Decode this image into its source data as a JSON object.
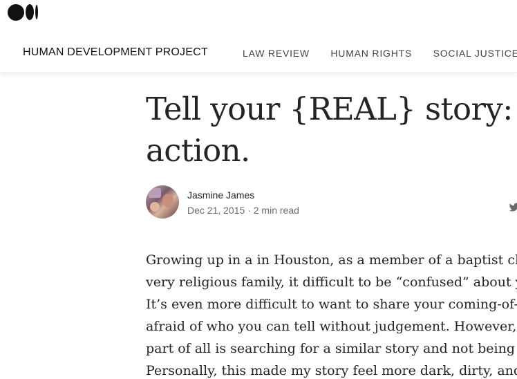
{
  "publication": {
    "name": "HUMAN DEVELOPMENT PROJECT",
    "nav": [
      "LAW REVIEW",
      "HUMAN RIGHTS",
      "SOCIAL JUSTICE"
    ]
  },
  "article": {
    "title_lines": [
      "Tell your {REAL} story: A",
      "action."
    ],
    "author": "Jasmine James",
    "date": "Dec 21, 2015",
    "read_time": "2 min read",
    "body_lines": [
      "Growing up in a in Houston, as a member of a baptist church",
      "very religious family, it difficult to be “confused” about your",
      "It’s even more difficult to want to share your coming-of-age s",
      "afraid of who you can tell without judgement. However, I be",
      "part of all is searching for a similar story and not being able t",
      "Personally, this made my story feel more dark, dirty, and sha"
    ]
  },
  "icons": {
    "logo": "medium-logo-icon",
    "share": "twitter-icon"
  }
}
